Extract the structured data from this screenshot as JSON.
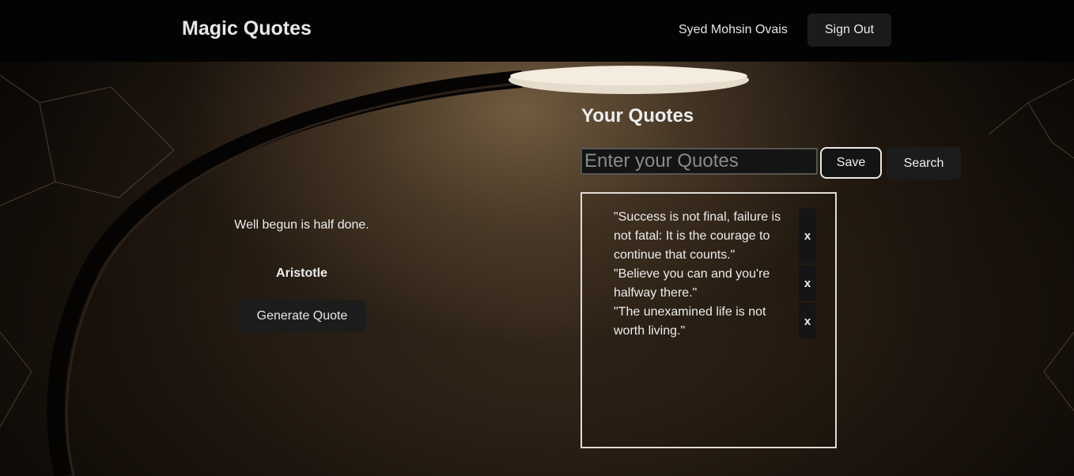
{
  "navbar": {
    "brand": "Magic Quotes",
    "username": "Syed Mohsin Ovais",
    "signout_label": "Sign Out"
  },
  "random_quote": {
    "text": "Well begun is half done.",
    "author": "Aristotle",
    "generate_label": "Generate Quote"
  },
  "your_quotes": {
    "title": "Your Quotes",
    "input_placeholder": "Enter your Quotes",
    "input_value": "",
    "save_label": "Save",
    "search_label": "Search",
    "items": [
      {
        "text": "\"Success is not final, failure is not fatal: It is the courage to continue that counts.\"",
        "delete_label": "x"
      },
      {
        "text": "\"Believe you can and you're halfway there.\"",
        "delete_label": "x"
      },
      {
        "text": "\"The unexamined life is not worth living.\"",
        "delete_label": "x"
      }
    ]
  },
  "colors": {
    "navbar_bg": "#030303",
    "button_bg": "#1c1c1c",
    "text": "#eeeeee"
  }
}
